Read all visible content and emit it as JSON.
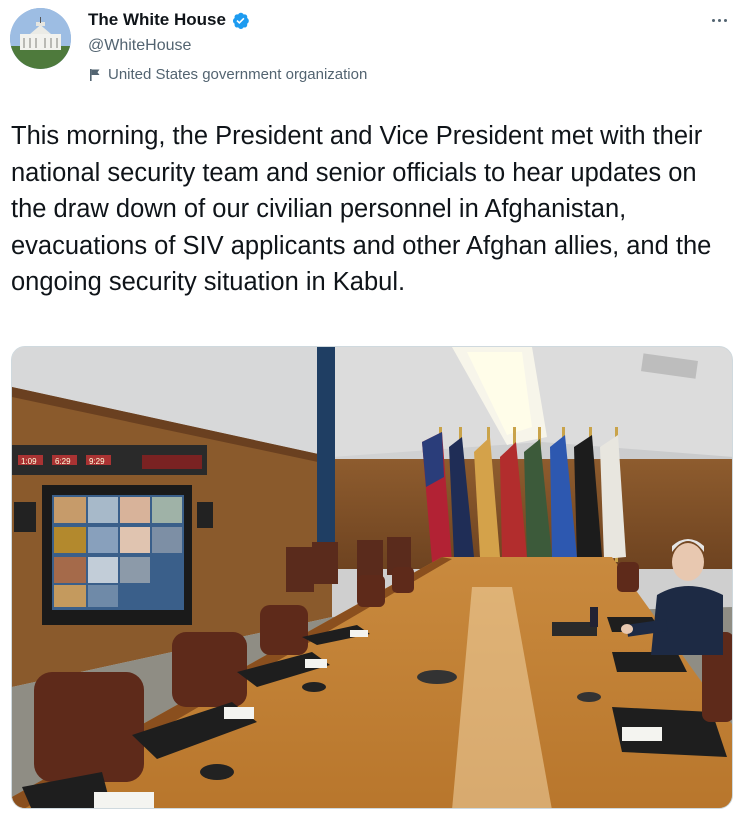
{
  "account": {
    "display_name": "The White House",
    "handle": "@WhiteHouse",
    "label": "United States government organization"
  },
  "tweet": {
    "text": "This morning, the President and Vice President met with their national security team and senior officials to hear updates on the draw down of our civilian personnel in Afghanistan, evacuations of SIV applicants and other Afghan allies, and the ongoing security situation in Kabul."
  },
  "photo_screen": {
    "readouts": [
      "1:09",
      "6:29",
      "9:29"
    ]
  },
  "icons": {
    "verified": "verified-badge-icon",
    "label": "flag-icon",
    "more": "more-icon"
  },
  "colors": {
    "verified_blue": "#1d9bf0",
    "secondary_text": "#536471",
    "primary_text": "#0f1419"
  }
}
